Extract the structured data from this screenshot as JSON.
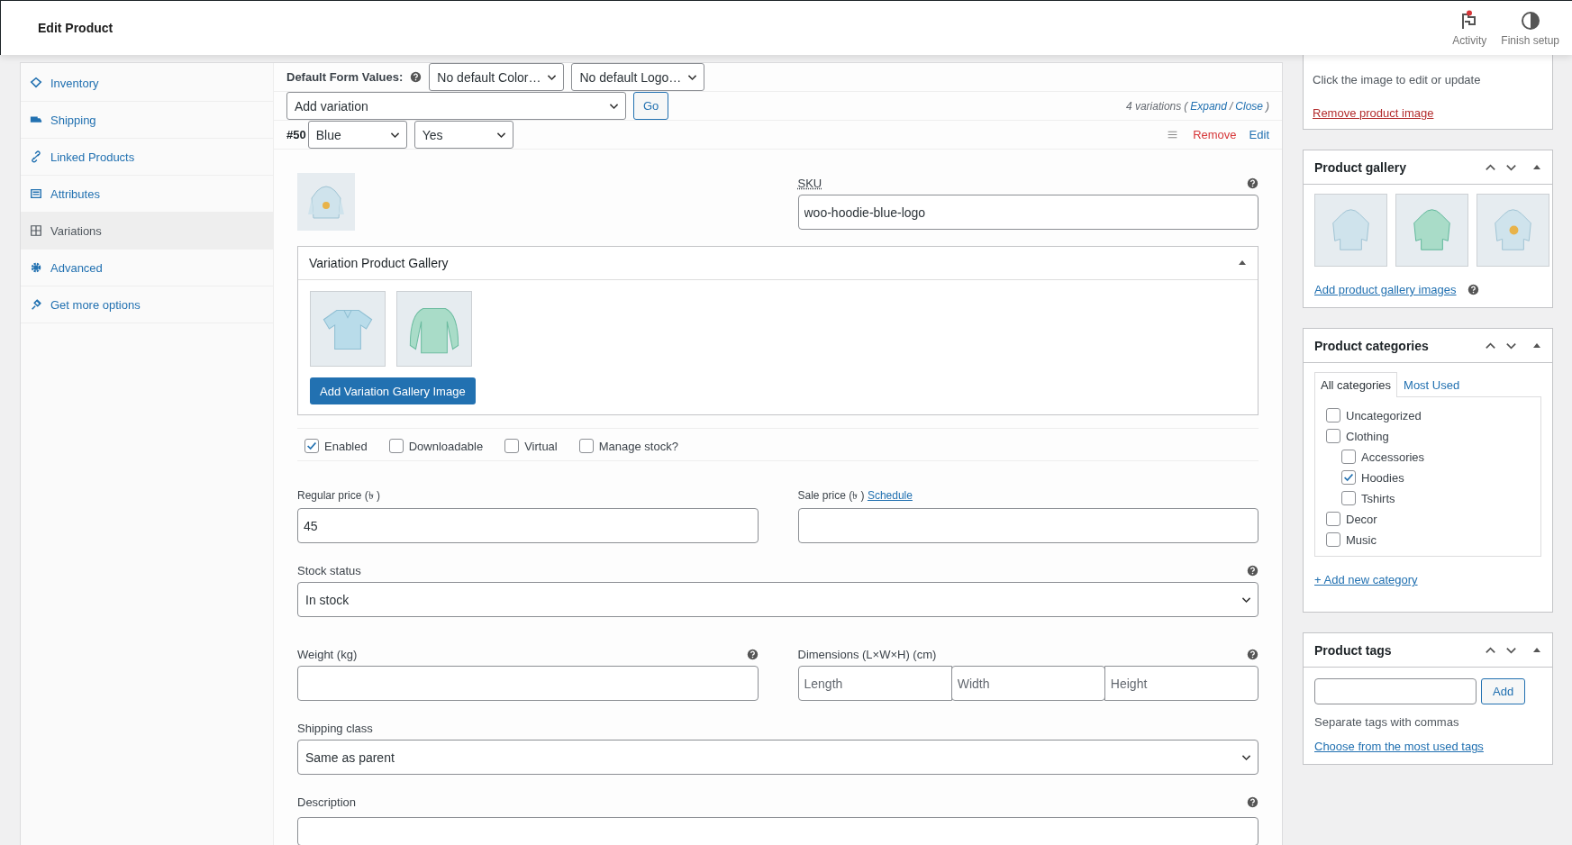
{
  "header": {
    "title": "Edit Product",
    "actions": [
      {
        "label": "Activity",
        "badge": true
      },
      {
        "label": "Finish setup",
        "badge": false
      }
    ]
  },
  "nav": [
    {
      "label": "Inventory",
      "selected": false
    },
    {
      "label": "Shipping",
      "selected": false
    },
    {
      "label": "Linked Products",
      "selected": false
    },
    {
      "label": "Attributes",
      "selected": false
    },
    {
      "label": "Variations",
      "selected": true
    },
    {
      "label": "Advanced",
      "selected": false
    },
    {
      "label": "Get more options",
      "selected": false
    }
  ],
  "defaults": {
    "label": "Default Form Values:",
    "selects": [
      "No default Color…",
      "No default Logo…"
    ]
  },
  "bulk": {
    "select": "Add variation",
    "button": "Go",
    "count": "4 variations",
    "open": "(",
    "links": [
      "Expand",
      "Close"
    ],
    "separator": "/",
    "close": ")"
  },
  "variation": {
    "number": "#50",
    "attributes": [
      "Blue",
      "Yes"
    ],
    "actions": [
      "Remove",
      "Edit"
    ],
    "sku": {
      "label": "SKU",
      "value": "woo-hoodie-blue-logo"
    },
    "gallery": {
      "title": "Variation Product Gallery",
      "button": "Add Variation Gallery Image"
    },
    "options": [
      {
        "label": "Enabled",
        "checked": true
      },
      {
        "label": "Downloadable",
        "checked": false
      },
      {
        "label": "Virtual",
        "checked": false
      },
      {
        "label": "Manage stock?",
        "checked": false
      }
    ],
    "regular_price": {
      "label": "Regular price (৳ )",
      "value": "45"
    },
    "sale_price": {
      "label": "Sale price (৳ )",
      "link": "Schedule"
    },
    "stock_status": {
      "label": "Stock status",
      "value": "In stock"
    },
    "weight": {
      "label": "Weight (kg)"
    },
    "dimensions": {
      "label": "Dimensions (L×W×H) (cm)",
      "placeholders": [
        "Length",
        "Width",
        "Height"
      ]
    },
    "shipping_class": {
      "label": "Shipping class",
      "value": "Same as parent"
    },
    "description": {
      "label": "Description"
    }
  },
  "product_image": {
    "hint": "Click the image to edit or update",
    "link": "Remove product image"
  },
  "product_gallery": {
    "title": "Product gallery",
    "link": "Add product gallery images"
  },
  "categories": {
    "title": "Product categories",
    "tabs": [
      {
        "label": "All categories",
        "selected": true
      },
      {
        "label": "Most Used",
        "selected": false
      }
    ],
    "items": [
      {
        "label": "Uncategorized",
        "checked": false
      },
      {
        "label": "Clothing",
        "checked": false,
        "children": [
          {
            "label": "Accessories",
            "checked": false
          },
          {
            "label": "Hoodies",
            "checked": true
          },
          {
            "label": "Tshirts",
            "checked": false
          }
        ]
      },
      {
        "label": "Decor",
        "checked": false
      },
      {
        "label": "Music",
        "checked": false
      }
    ],
    "add_link": "+ Add new category"
  },
  "tags": {
    "title": "Product tags",
    "button": "Add",
    "hint": "Separate tags with commas",
    "link": "Choose from the most used tags"
  }
}
